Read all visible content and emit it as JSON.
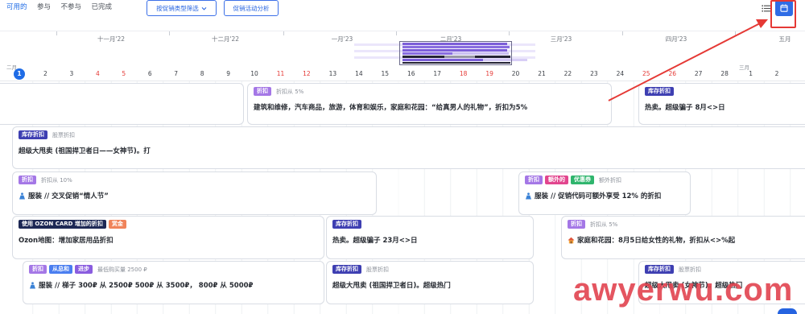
{
  "tabs": {
    "items": [
      {
        "label": "可用的",
        "active": true
      },
      {
        "label": "参与"
      },
      {
        "label": "不参与"
      },
      {
        "label": "已完成"
      }
    ]
  },
  "toolbar": {
    "filter_label": "按促销类型筛选",
    "filter_icon": "chevron-down-icon",
    "analysis_label": "促销活动分析",
    "list_view_icon": "list-icon",
    "calendar_view_icon": "calendar-icon",
    "calendar_view_active": true
  },
  "timeline": {
    "months": [
      "十一月'22",
      "十二月'22",
      "一月'23",
      "二月'23",
      "三月'23",
      "四月'23",
      "五月"
    ],
    "current_month": "二月",
    "next_month": "三月",
    "days": [
      {
        "n": "1",
        "today": true
      },
      {
        "n": "2"
      },
      {
        "n": "3"
      },
      {
        "n": "4",
        "weekend": true
      },
      {
        "n": "5",
        "weekend": true
      },
      {
        "n": "6"
      },
      {
        "n": "7"
      },
      {
        "n": "8"
      },
      {
        "n": "9"
      },
      {
        "n": "10"
      },
      {
        "n": "11",
        "weekend": true
      },
      {
        "n": "12",
        "weekend": true
      },
      {
        "n": "13"
      },
      {
        "n": "14"
      },
      {
        "n": "15"
      },
      {
        "n": "16"
      },
      {
        "n": "17"
      },
      {
        "n": "18",
        "weekend": true
      },
      {
        "n": "19",
        "weekend": true
      },
      {
        "n": "20"
      },
      {
        "n": "21"
      },
      {
        "n": "22"
      },
      {
        "n": "23"
      },
      {
        "n": "24"
      },
      {
        "n": "25",
        "weekend": true
      },
      {
        "n": "26",
        "weekend": true
      },
      {
        "n": "27"
      },
      {
        "n": "28"
      },
      {
        "n": "1"
      },
      {
        "n": "2"
      }
    ]
  },
  "colors": {
    "accent": "#1f6ce6",
    "weekend": "#e53935",
    "annotation": "#e53935",
    "watermark": "#e2434f"
  },
  "cards": [
    {
      "badges": [
        {
          "label": "折扣",
          "color": "#a477e6"
        }
      ],
      "note": "折扣从 5%",
      "title": "建筑和维修，汽车商品，旅游，体育和娱乐，家庭和花园：“给真男人的礼物”，折扣为5%"
    },
    {
      "badges": [
        {
          "label": "库存折扣",
          "color": "#3e3fb2"
        }
      ],
      "title": "热卖。超级骗子 8月<>日"
    },
    {
      "badges": [
        {
          "label": "库存折扣",
          "color": "#3e3fb2"
        }
      ],
      "note": "股票折扣",
      "title": "超级大甩卖 (祖国捍卫者日——女神节)。打"
    },
    {
      "badges": [
        {
          "label": "折扣",
          "color": "#a477e6"
        }
      ],
      "note": "折扣从 10%",
      "icon": "clothing-icon",
      "title": "服装 // 交叉促销“情人节”"
    },
    {
      "badges": [
        {
          "label": "折扣",
          "color": "#a477e6"
        },
        {
          "label": "额外的",
          "color": "#e2458e"
        },
        {
          "label": "优惠券",
          "color": "#2fb56d"
        }
      ],
      "note": "额外折扣",
      "icon": "clothing-icon",
      "title": "服装 // 促销代码可额外享受 12% 的折扣"
    },
    {
      "badges": [
        {
          "label": "使用 OZON CARD 增加的折扣",
          "color": "#1d2855"
        },
        {
          "label": "赏金",
          "color": "#f0835a"
        }
      ],
      "title": "Ozon地图：增加家居用品折扣"
    },
    {
      "badges": [
        {
          "label": "库存折扣",
          "color": "#3e3fb2"
        }
      ],
      "title": "热卖。超级骗子 23月<>日"
    },
    {
      "badges": [
        {
          "label": "折扣",
          "color": "#a477e6"
        }
      ],
      "note": "折扣从 5%",
      "icon": "home-icon",
      "title": "家庭和花园：8月5日给女性的礼物，折扣从<>%起"
    },
    {
      "badges": [
        {
          "label": "折扣",
          "color": "#a477e6"
        },
        {
          "label": "从总和",
          "color": "#4a7ef0"
        },
        {
          "label": "进步",
          "color": "#8a5ddf"
        }
      ],
      "note": "最低购买量 2500 ₽",
      "icon": "clothing-icon",
      "title": "服装 // 梯子 300₽ 从 2500₽ 500₽ 从 3500₽， 800₽ 从 5000₽"
    },
    {
      "badges": [
        {
          "label": "库存折扣",
          "color": "#3e3fb2"
        }
      ],
      "note": "股票折扣",
      "title": "超级大甩卖 (祖国捍卫者日)。超级热门"
    },
    {
      "badges": [
        {
          "label": "库存折扣",
          "color": "#3e3fb2"
        }
      ],
      "note": "股票折扣",
      "title": "超级大甩卖 (女神节)。超级热门"
    }
  ],
  "watermark": {
    "text": "awyerwu.com"
  }
}
